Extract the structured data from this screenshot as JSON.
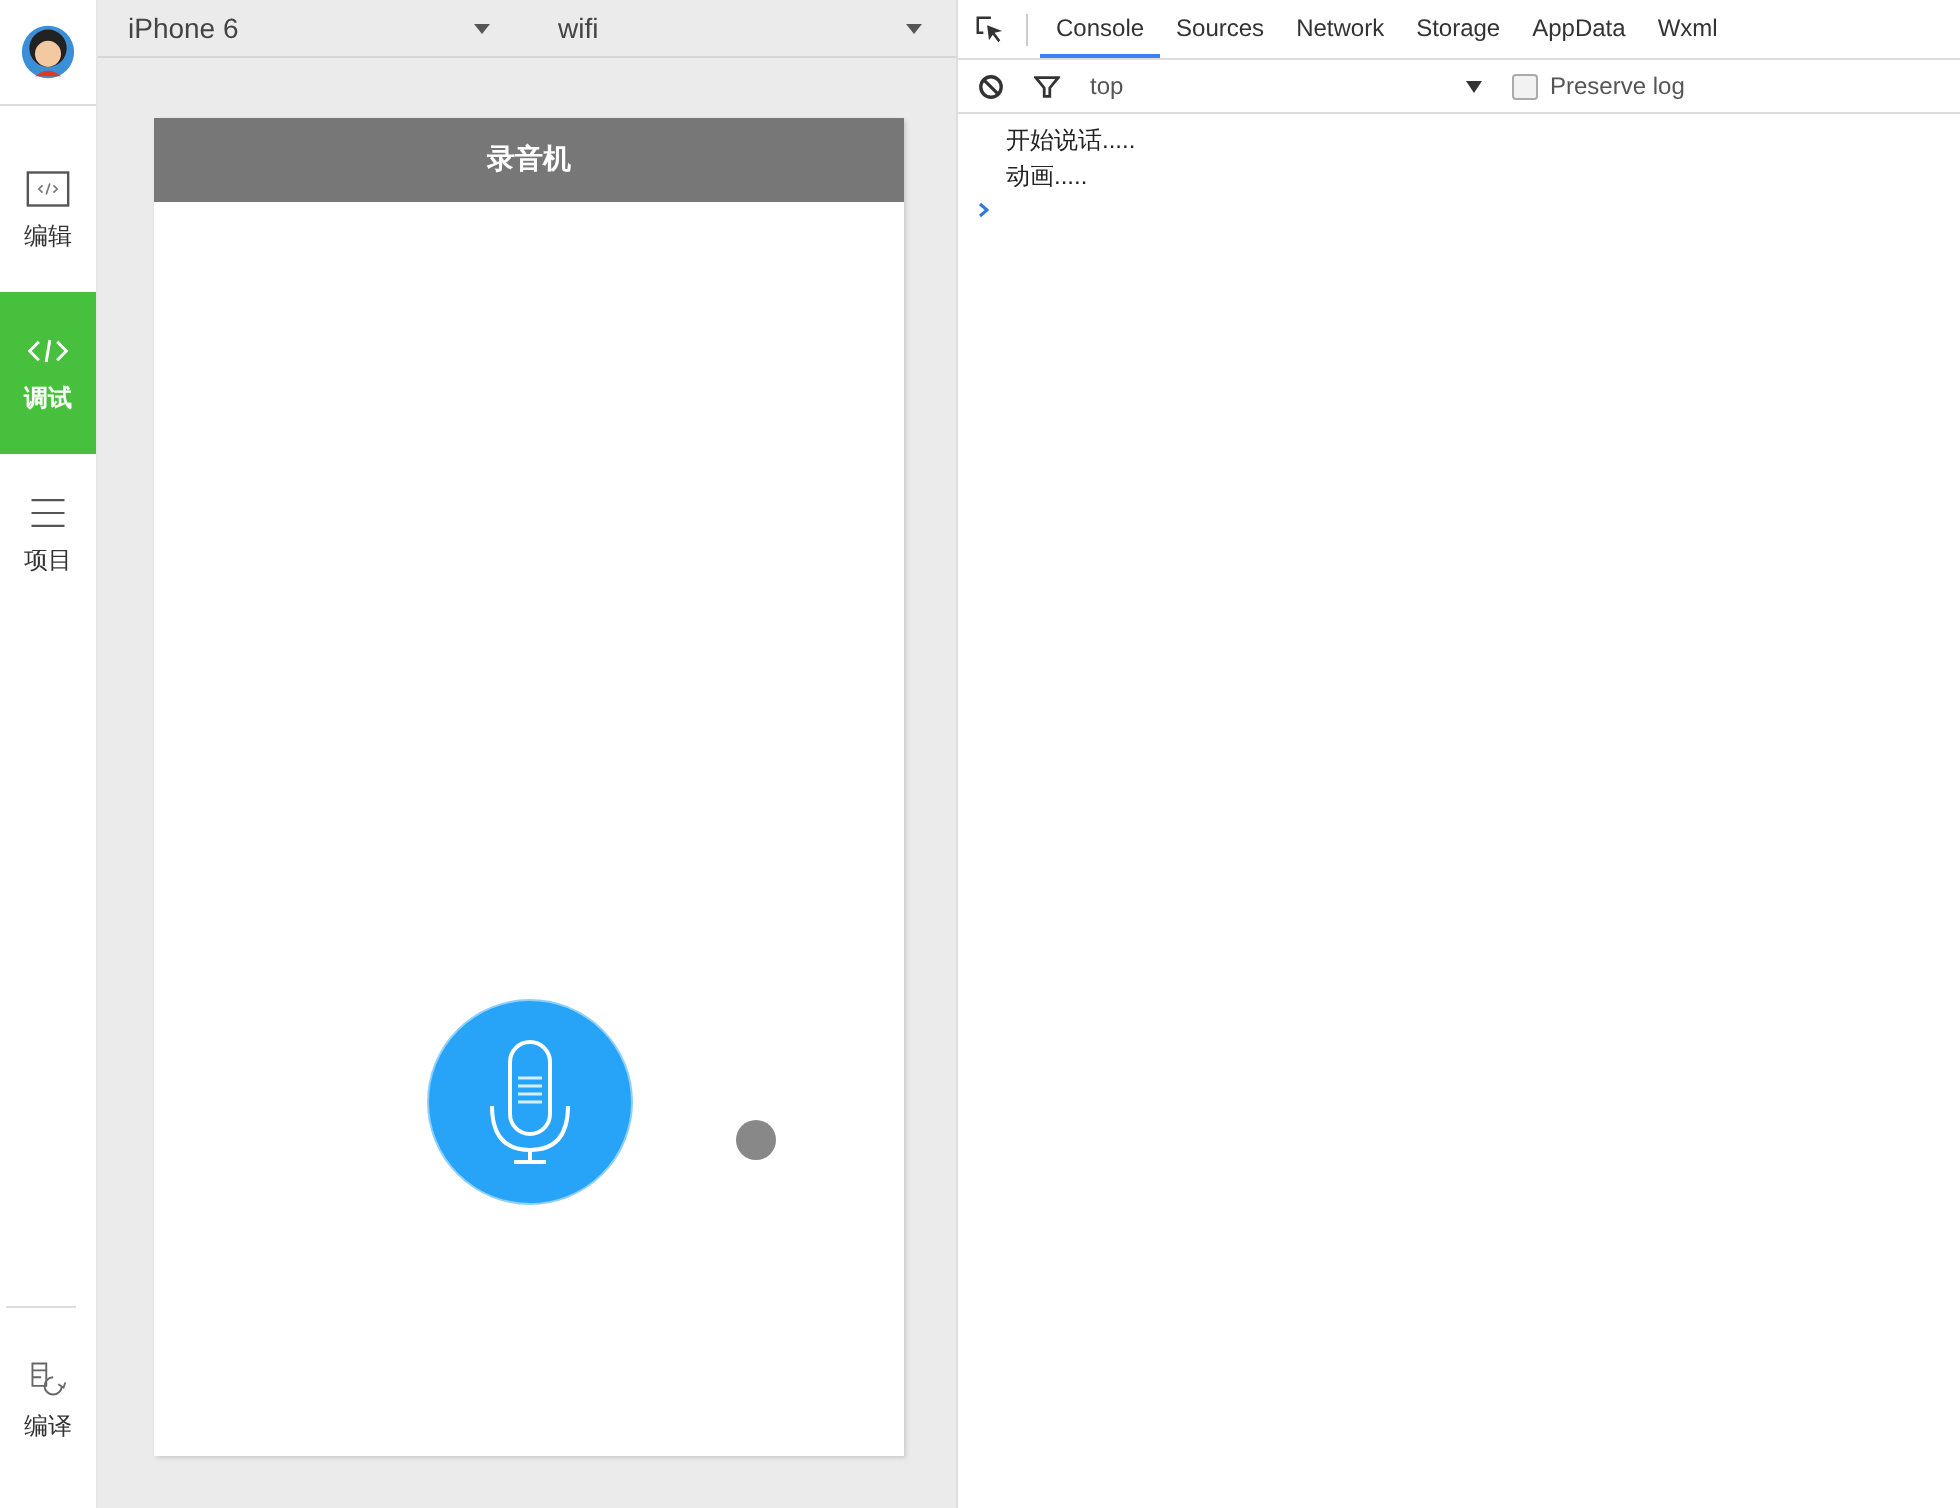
{
  "sidebar": {
    "items": [
      {
        "label": "编辑",
        "kind": "code-box",
        "selected": false
      },
      {
        "label": "调试",
        "kind": "code",
        "selected": true
      },
      {
        "label": "项目",
        "kind": "lines",
        "selected": false
      }
    ],
    "bottom_item": {
      "label": "编译"
    }
  },
  "simulator": {
    "device": "iPhone 6",
    "network": "wifi",
    "nav_title": "录音机"
  },
  "devtools": {
    "tabs": [
      {
        "label": "Console",
        "selected": true
      },
      {
        "label": "Sources",
        "selected": false
      },
      {
        "label": "Network",
        "selected": false
      },
      {
        "label": "Storage",
        "selected": false
      },
      {
        "label": "AppData",
        "selected": false
      },
      {
        "label": "Wxml",
        "selected": false
      }
    ],
    "context": "top",
    "preserve_log": {
      "label": "Preserve log",
      "checked": false
    },
    "console_lines": [
      "开始说话.....",
      "动画....."
    ]
  }
}
